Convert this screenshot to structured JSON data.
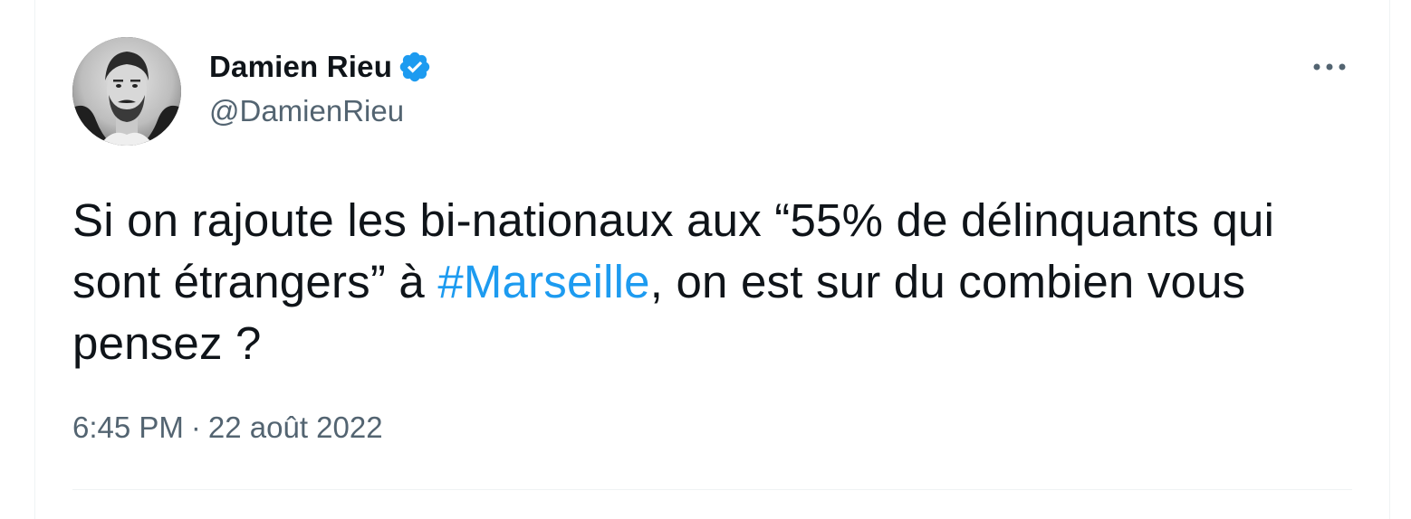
{
  "author": {
    "display_name": "Damien Rieu",
    "handle": "@DamienRieu",
    "verified": true
  },
  "tweet": {
    "text_before": "Si on rajoute les bi-nationaux aux “55% de délinquants qui sont étrangers” à ",
    "hashtag": "#Marseille",
    "text_after": ", on est sur du combien vous pensez ?"
  },
  "meta": {
    "time": "6:45 PM",
    "separator": "·",
    "date": "22 août 2022"
  },
  "icons": {
    "verified": "verified-badge-icon",
    "more": "more-options-icon"
  },
  "colors": {
    "accent": "#1d9bf0",
    "text": "#0f1419",
    "secondary": "#536471",
    "border": "#eff3f4"
  }
}
